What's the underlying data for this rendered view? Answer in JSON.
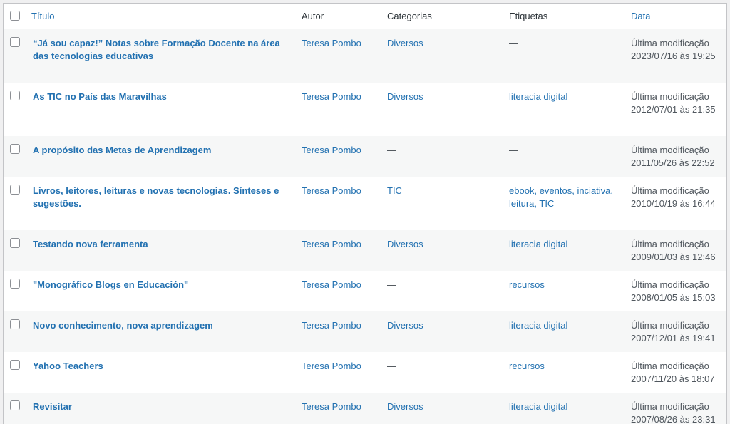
{
  "columns": {
    "title": "Título",
    "author": "Autor",
    "categories": "Categorias",
    "tags": "Etiquetas",
    "date": "Data"
  },
  "rows": [
    {
      "title": "“Já sou capaz!” Notas sobre Formação Docente na área das tecnologias educativas",
      "author": "Teresa Pombo",
      "categories": [
        "Diversos"
      ],
      "tags": [],
      "date_status": "Última modificação",
      "date_value": "2023/07/16 às 19:25"
    },
    {
      "title": "As TIC no País das Maravilhas",
      "author": "Teresa Pombo",
      "categories": [
        "Diversos"
      ],
      "tags": [
        "literacia digital"
      ],
      "date_status": "Última modificação",
      "date_value": "2012/07/01 às 21:35"
    },
    {
      "title": "A propósito das Metas de Aprendizagem",
      "author": "Teresa Pombo",
      "categories": [],
      "tags": [],
      "date_status": "Última modificação",
      "date_value": "2011/05/26 às 22:52"
    },
    {
      "title": "Livros, leitores, leituras e novas tecnologias. Sínteses e sugestões.",
      "author": "Teresa Pombo",
      "categories": [
        "TIC"
      ],
      "tags": [
        "ebook",
        "eventos",
        "inciativa",
        "leitura",
        "TIC"
      ],
      "date_status": "Última modificação",
      "date_value": "2010/10/19 às 16:44"
    },
    {
      "title": "Testando nova ferramenta",
      "author": "Teresa Pombo",
      "categories": [
        "Diversos"
      ],
      "tags": [
        "literacia digital"
      ],
      "date_status": "Última modificação",
      "date_value": "2009/01/03 às 12:46"
    },
    {
      "title": "\"Monográfico Blogs en Educación\"",
      "author": "Teresa Pombo",
      "categories": [],
      "tags": [
        "recursos"
      ],
      "date_status": "Última modificação",
      "date_value": "2008/01/05 às 15:03"
    },
    {
      "title": "Novo conhecimento, nova aprendizagem",
      "author": "Teresa Pombo",
      "categories": [
        "Diversos"
      ],
      "tags": [
        "literacia digital"
      ],
      "date_status": "Última modificação",
      "date_value": "2007/12/01 às 19:41"
    },
    {
      "title": "Yahoo Teachers",
      "author": "Teresa Pombo",
      "categories": [],
      "tags": [
        "recursos"
      ],
      "date_status": "Última modificação",
      "date_value": "2007/11/20 às 18:07"
    },
    {
      "title": "Revisitar",
      "author": "Teresa Pombo",
      "categories": [
        "Diversos"
      ],
      "tags": [
        "literacia digital"
      ],
      "date_status": "Última modificação",
      "date_value": "2007/08/26 às 23:31"
    }
  ],
  "empty_placeholder": "—",
  "colors": {
    "link": "#2271b1",
    "text": "#3c434a",
    "row_alt": "#f6f7f7",
    "border": "#c3c4c7"
  }
}
